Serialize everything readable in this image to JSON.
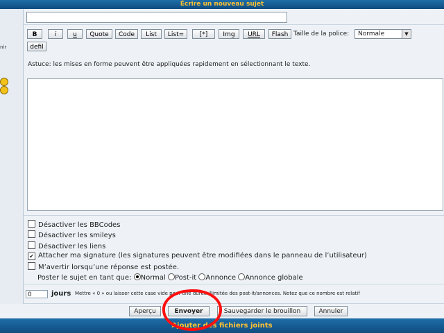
{
  "header": {
    "title": "Écrire un nouveau sujet"
  },
  "sidebar": {
    "label_fragment": "nir"
  },
  "subject": {
    "value": ""
  },
  "toolbar": {
    "buttons": [
      "B",
      "i",
      "u",
      "Quote",
      "Code",
      "List",
      "List=",
      "[*]",
      "Img",
      "URL",
      "Flash",
      "defil"
    ],
    "font_size_label": "Taille de la police:",
    "font_size_value": "Normale"
  },
  "tip": "Astuce: les mises en forme peuvent être appliquées rapidement en sélectionnant le texte.",
  "message": {
    "value": ""
  },
  "options": {
    "items": [
      {
        "label": "Désactiver les BBCodes",
        "checked": false
      },
      {
        "label": "Désactiver les smileys",
        "checked": false
      },
      {
        "label": "Désactiver les liens",
        "checked": false
      },
      {
        "label": "Attacher ma signature (les signatures peuvent être modifiées dans le panneau de l’utilisateur)",
        "checked": true
      },
      {
        "label": "M’avertir lorsqu’une réponse est postée.",
        "checked": false
      }
    ],
    "post_as_label": "Poster le sujet en tant que:",
    "post_types": [
      {
        "label": "Normal",
        "selected": true
      },
      {
        "label": "Post-it",
        "selected": false
      },
      {
        "label": "Annonce",
        "selected": false
      },
      {
        "label": "Annonce globale",
        "selected": false
      }
    ]
  },
  "duration": {
    "value": "0",
    "unit": "jours",
    "help": "Mettre « 0 » ou laisser cette case vide pour une durée illimitée des post-it/annonces. Notez que ce nombre est relatif"
  },
  "actions": {
    "preview": "Aperçu",
    "submit": "Envoyer",
    "save_draft": "Sauvegarder le brouillon",
    "cancel": "Annuler"
  },
  "footer": {
    "attachments_title": "Ajouter des fichiers joints"
  },
  "colors": {
    "bar": "#15588f",
    "bar_text": "#ffc233",
    "panel": "#eef2f6",
    "annotation": "#ff1010"
  }
}
